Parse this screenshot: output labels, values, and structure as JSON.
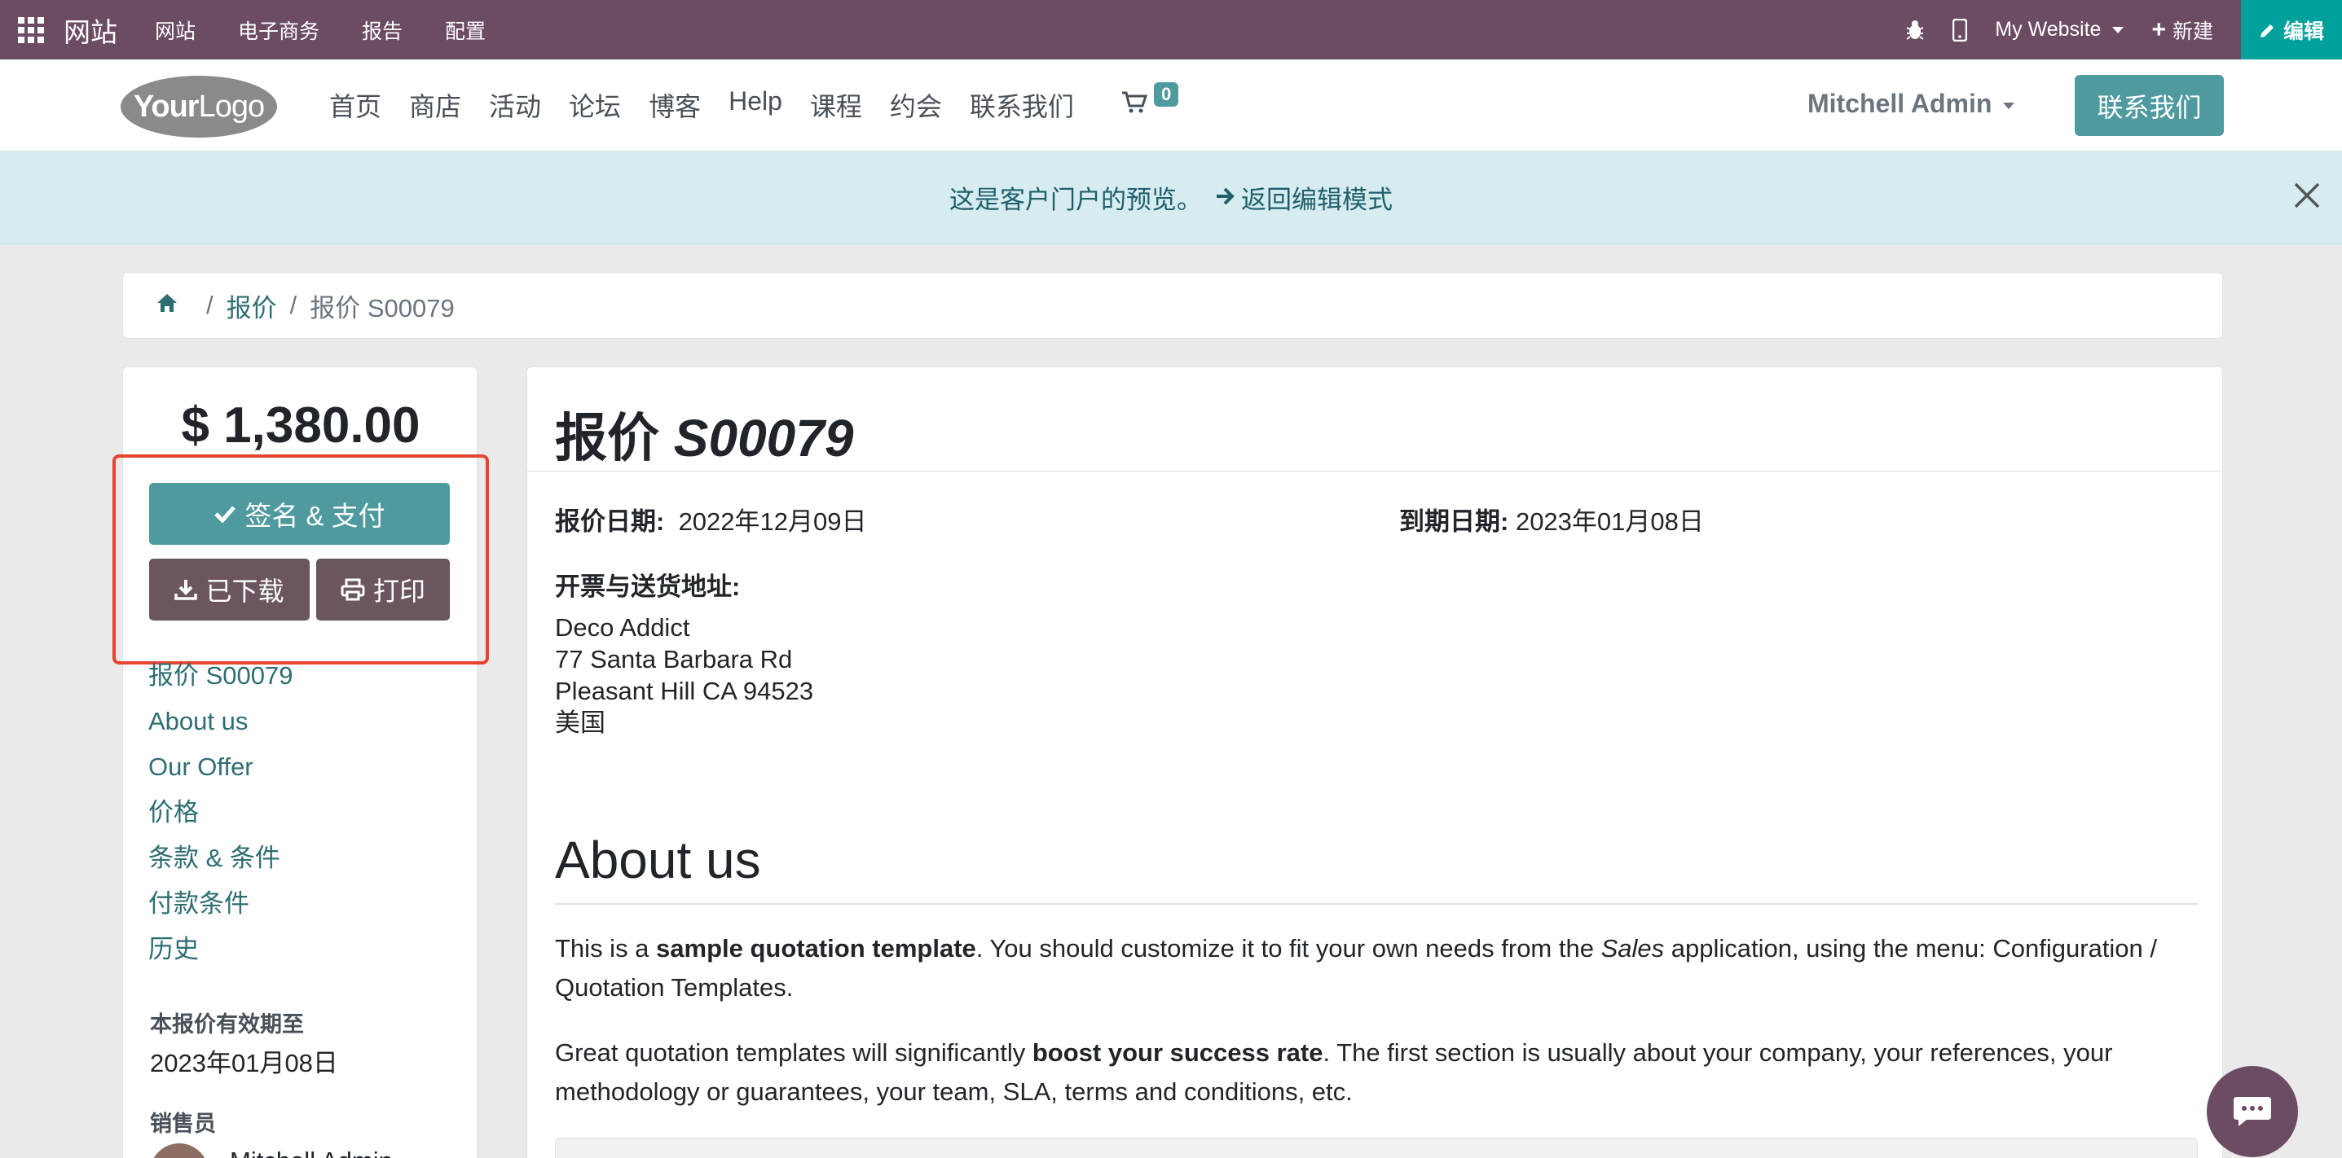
{
  "adminbar": {
    "brand": "网站",
    "menus": [
      "网站",
      "电子商务",
      "报告",
      "配置"
    ],
    "website_selector": "My Website",
    "new_label": "新建",
    "edit_label": "编辑"
  },
  "header": {
    "logo_text_bold": "Your",
    "logo_text": "Logo",
    "nav": [
      "首页",
      "商店",
      "活动",
      "论坛",
      "博客",
      "Help",
      "课程",
      "约会",
      "联系我们"
    ],
    "cart_count": "0",
    "user_name": "Mitchell Admin",
    "contact_button": "联系我们"
  },
  "preview_bar": {
    "message": "这是客户门户的预览。",
    "link": "返回编辑模式"
  },
  "breadcrumb": {
    "items": [
      "报价",
      "报价 S00079"
    ]
  },
  "sidebar": {
    "amount": "$ 1,380.00",
    "sign_pay": "签名 & 支付",
    "download": "已下载",
    "print": "打印",
    "toc": [
      "报价 S00079",
      "About us",
      "Our Offer",
      "价格",
      "条款 & 条件",
      "付款条件",
      "历史"
    ],
    "valid_until_label": "本报价有效期至",
    "valid_until": "2023年01月08日",
    "salesperson_label": "销售员",
    "salesperson": "Mitchell Admin"
  },
  "quote": {
    "title_prefix": "报价",
    "title_number": "S00079",
    "quote_date_label": "报价日期:",
    "quote_date": "2022年12月09日",
    "expiry_label": "到期日期:",
    "expiry": "2023年01月08日",
    "address_label": "开票与送货地址:",
    "address_lines": [
      "Deco Addict",
      "77 Santa Barbara Rd",
      "Pleasant Hill CA 94523",
      "美国"
    ],
    "about_heading": "About us",
    "para1": {
      "a": "This is a ",
      "b": "sample quotation template",
      "c": ". You should customize it to fit your own needs from the ",
      "d": "Sales",
      "e": " application, using the menu: Configuration / Quotation Templates."
    },
    "para2": {
      "a": "Great quotation templates will significantly ",
      "b": "boost your success rate",
      "c": ". The first section is usually about your company, your references, your methodology or guarantees, your team, SLA, terms and conditions, etc."
    }
  },
  "colors": {
    "admin_bar": "#6b4c63",
    "primary": "#4e9a9e",
    "secondary": "#6b5660",
    "highlight_border": "#e8432f"
  }
}
